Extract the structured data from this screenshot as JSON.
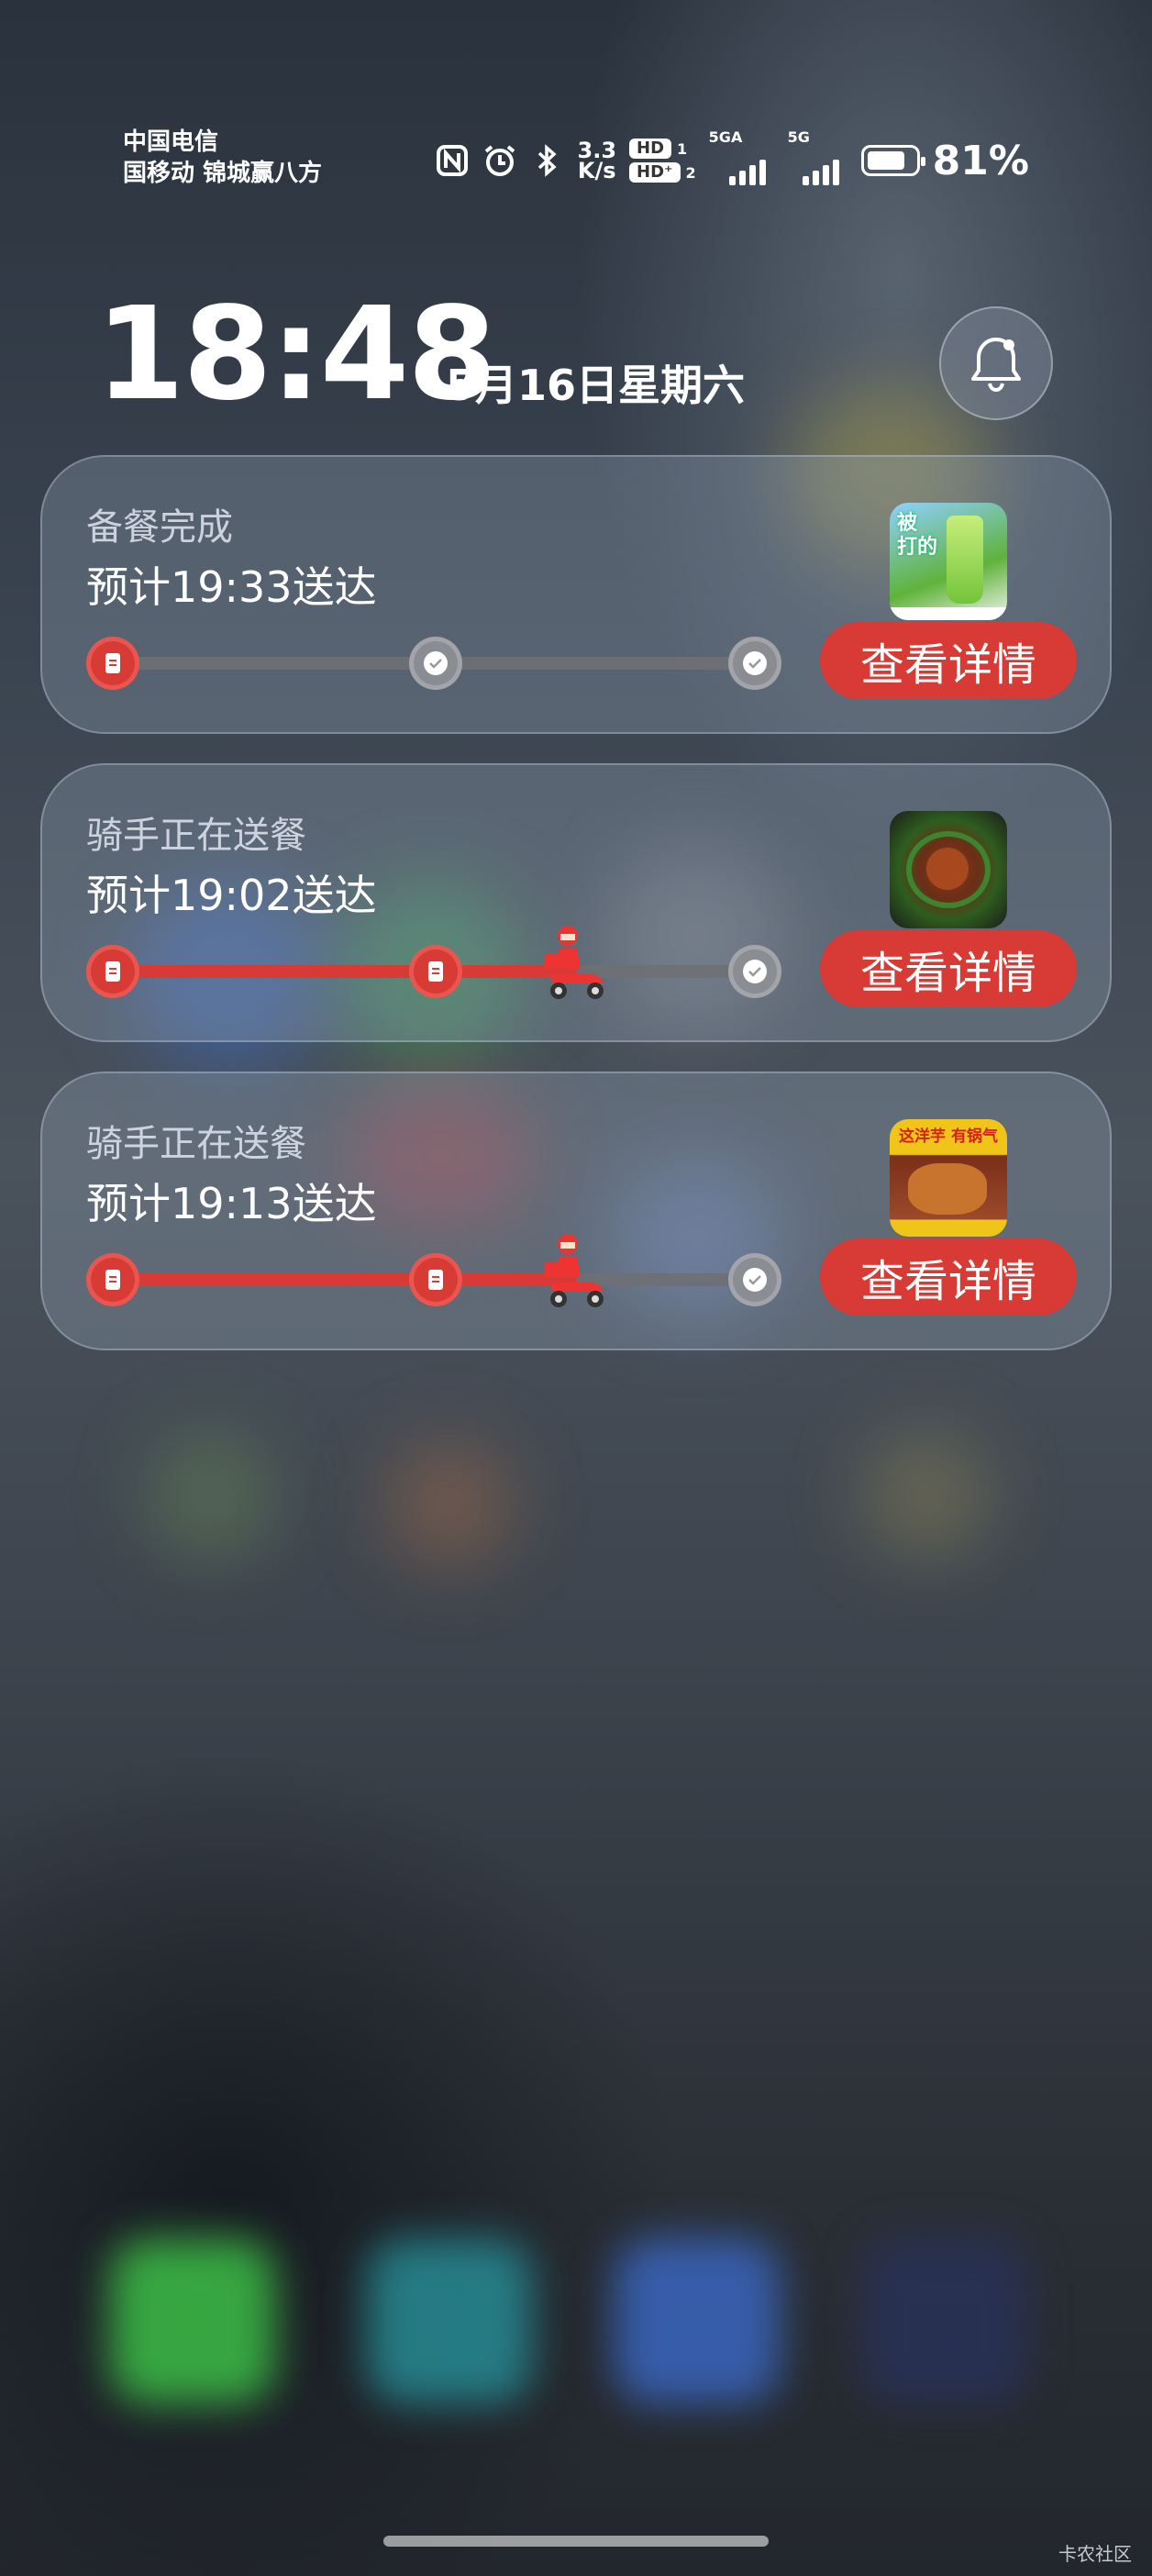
{
  "status_bar": {
    "carrier_line1": "中国电信",
    "carrier_line2": "国移动 锦城赢八方",
    "net_speed_value": "3.3",
    "net_speed_unit": "K/s",
    "hd1": "HD",
    "hd1_index": "1",
    "hd2": "HD⁺",
    "hd2_index": "2",
    "signal1_label": "5GA",
    "signal2_label": "5G",
    "battery_level": 0.81,
    "battery_text": "81%",
    "icons": [
      "nfc-icon",
      "alarm-icon",
      "bluetooth-icon"
    ]
  },
  "lock": {
    "time": "18:48",
    "date": "5月16日星期六"
  },
  "cards": [
    {
      "status": "备餐完成",
      "eta": "预计19:33送达",
      "progress": 0.0,
      "stage_nodes": [
        "done",
        "pending",
        "pending"
      ],
      "rider_visible": false,
      "button": "查看详情",
      "thumb": "drink"
    },
    {
      "status": "骑手正在送餐",
      "eta": "预计19:02送达",
      "progress": 0.72,
      "stage_nodes": [
        "done",
        "done",
        "pending"
      ],
      "rider_visible": true,
      "button": "查看详情",
      "thumb": "stirfry"
    },
    {
      "status": "骑手正在送餐",
      "eta": "预计19:13送达",
      "progress": 0.72,
      "stage_nodes": [
        "done",
        "done",
        "pending"
      ],
      "rider_visible": true,
      "button": "查看详情",
      "thumb": "taro"
    }
  ],
  "thumb_text": {
    "drink_line1": "被",
    "drink_line2": "打的",
    "taro_banner": "这洋芋 有锅气"
  },
  "watermark": "卡农社区",
  "colors": {
    "accent": "#d83b35",
    "track": "#6e7074"
  }
}
